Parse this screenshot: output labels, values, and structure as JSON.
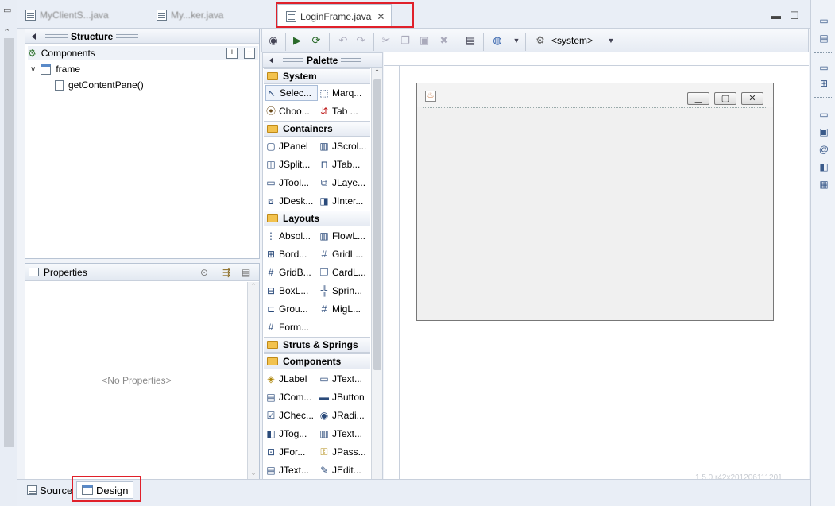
{
  "editor_tabs": [
    {
      "label": "MyClientS...java",
      "active": false
    },
    {
      "label": "My...ker.java",
      "active": false
    },
    {
      "label": "LoginFrame.java",
      "active": true
    }
  ],
  "structure": {
    "title": "Structure",
    "components_label": "Components",
    "tree": [
      {
        "label": "frame",
        "level": 0
      },
      {
        "label": "getContentPane()",
        "level": 1
      }
    ]
  },
  "properties": {
    "title": "Properties",
    "empty_text": "<No Properties>"
  },
  "toolbar": {
    "system_label": "<system>"
  },
  "palette": {
    "title": "Palette",
    "categories": [
      {
        "name": "System",
        "items": [
          "Selec...",
          "Marq...",
          "Choo...",
          "Tab ..."
        ]
      },
      {
        "name": "Containers",
        "items": [
          "JPanel",
          "JScrol...",
          "JSplit...",
          "JTab...",
          "JTool...",
          "JLaye...",
          "JDesk...",
          "JInter..."
        ]
      },
      {
        "name": "Layouts",
        "items": [
          "Absol...",
          "FlowL...",
          "Bord...",
          "GridL...",
          "GridB...",
          "CardL...",
          "BoxL...",
          "Sprin...",
          "Grou...",
          "MigL...",
          "Form..."
        ]
      },
      {
        "name": "Struts & Springs",
        "items": []
      },
      {
        "name": "Components",
        "items": [
          "JLabel",
          "JText...",
          "JCom...",
          "JButton",
          "JChec...",
          "JRadi...",
          "JTog...",
          "JText...",
          "JFor...",
          "JPass...",
          "JText...",
          "JEdit..."
        ]
      }
    ]
  },
  "bottom_tabs": {
    "source": "Source",
    "design": "Design"
  },
  "version_text": "1.5.0.r42x201206111201",
  "colors": {
    "highlight_box": "#e0202a",
    "panel_header": "#e2e8f1"
  }
}
